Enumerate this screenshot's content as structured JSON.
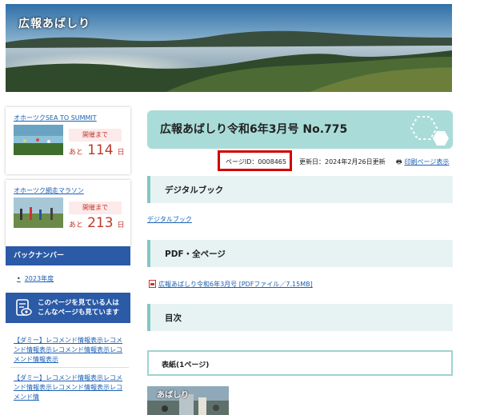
{
  "banner": {
    "title": "広報あばしり"
  },
  "sidebar": {
    "events": [
      {
        "link": "オホーツクSEA TO SUMMIT",
        "status": "開催まで",
        "prefix": "あと",
        "count": "114",
        "unit": "日"
      },
      {
        "link": "オホーツク網走マラソン",
        "status": "開催まで",
        "prefix": "あと",
        "count": "213",
        "unit": "日"
      }
    ],
    "backnumber": {
      "heading": "バックナンバー",
      "items": [
        "2023年度"
      ]
    },
    "recommend": {
      "heading_line1": "このページを見ている人は",
      "heading_line2": "こんなページも見ています",
      "links": [
        "【ダミー】レコメンド情報表示レコメンド情報表示レコメンド情報表示レコメンド情報表示",
        "【ダミー】レコメンド情報表示レコメンド情報表示レコメンド情報表示レコメンド情"
      ]
    }
  },
  "main": {
    "title": "広報あばしり令和6年3月号 No.775",
    "page_id": "ページID：0008465",
    "updated": "更新日：2024年2月26日更新",
    "print_label": "印刷ページ表示",
    "sections": {
      "digital": "デジタルブック",
      "pdf": "PDF・全ページ",
      "toc": "目次"
    },
    "digital_link": "デジタルブック",
    "pdf_link": "広報あばしり令和6年3月号 [PDFファイル／7.15MB]",
    "cover_heading": "表紙(1ページ)",
    "thumb_title": "あばしり"
  }
}
